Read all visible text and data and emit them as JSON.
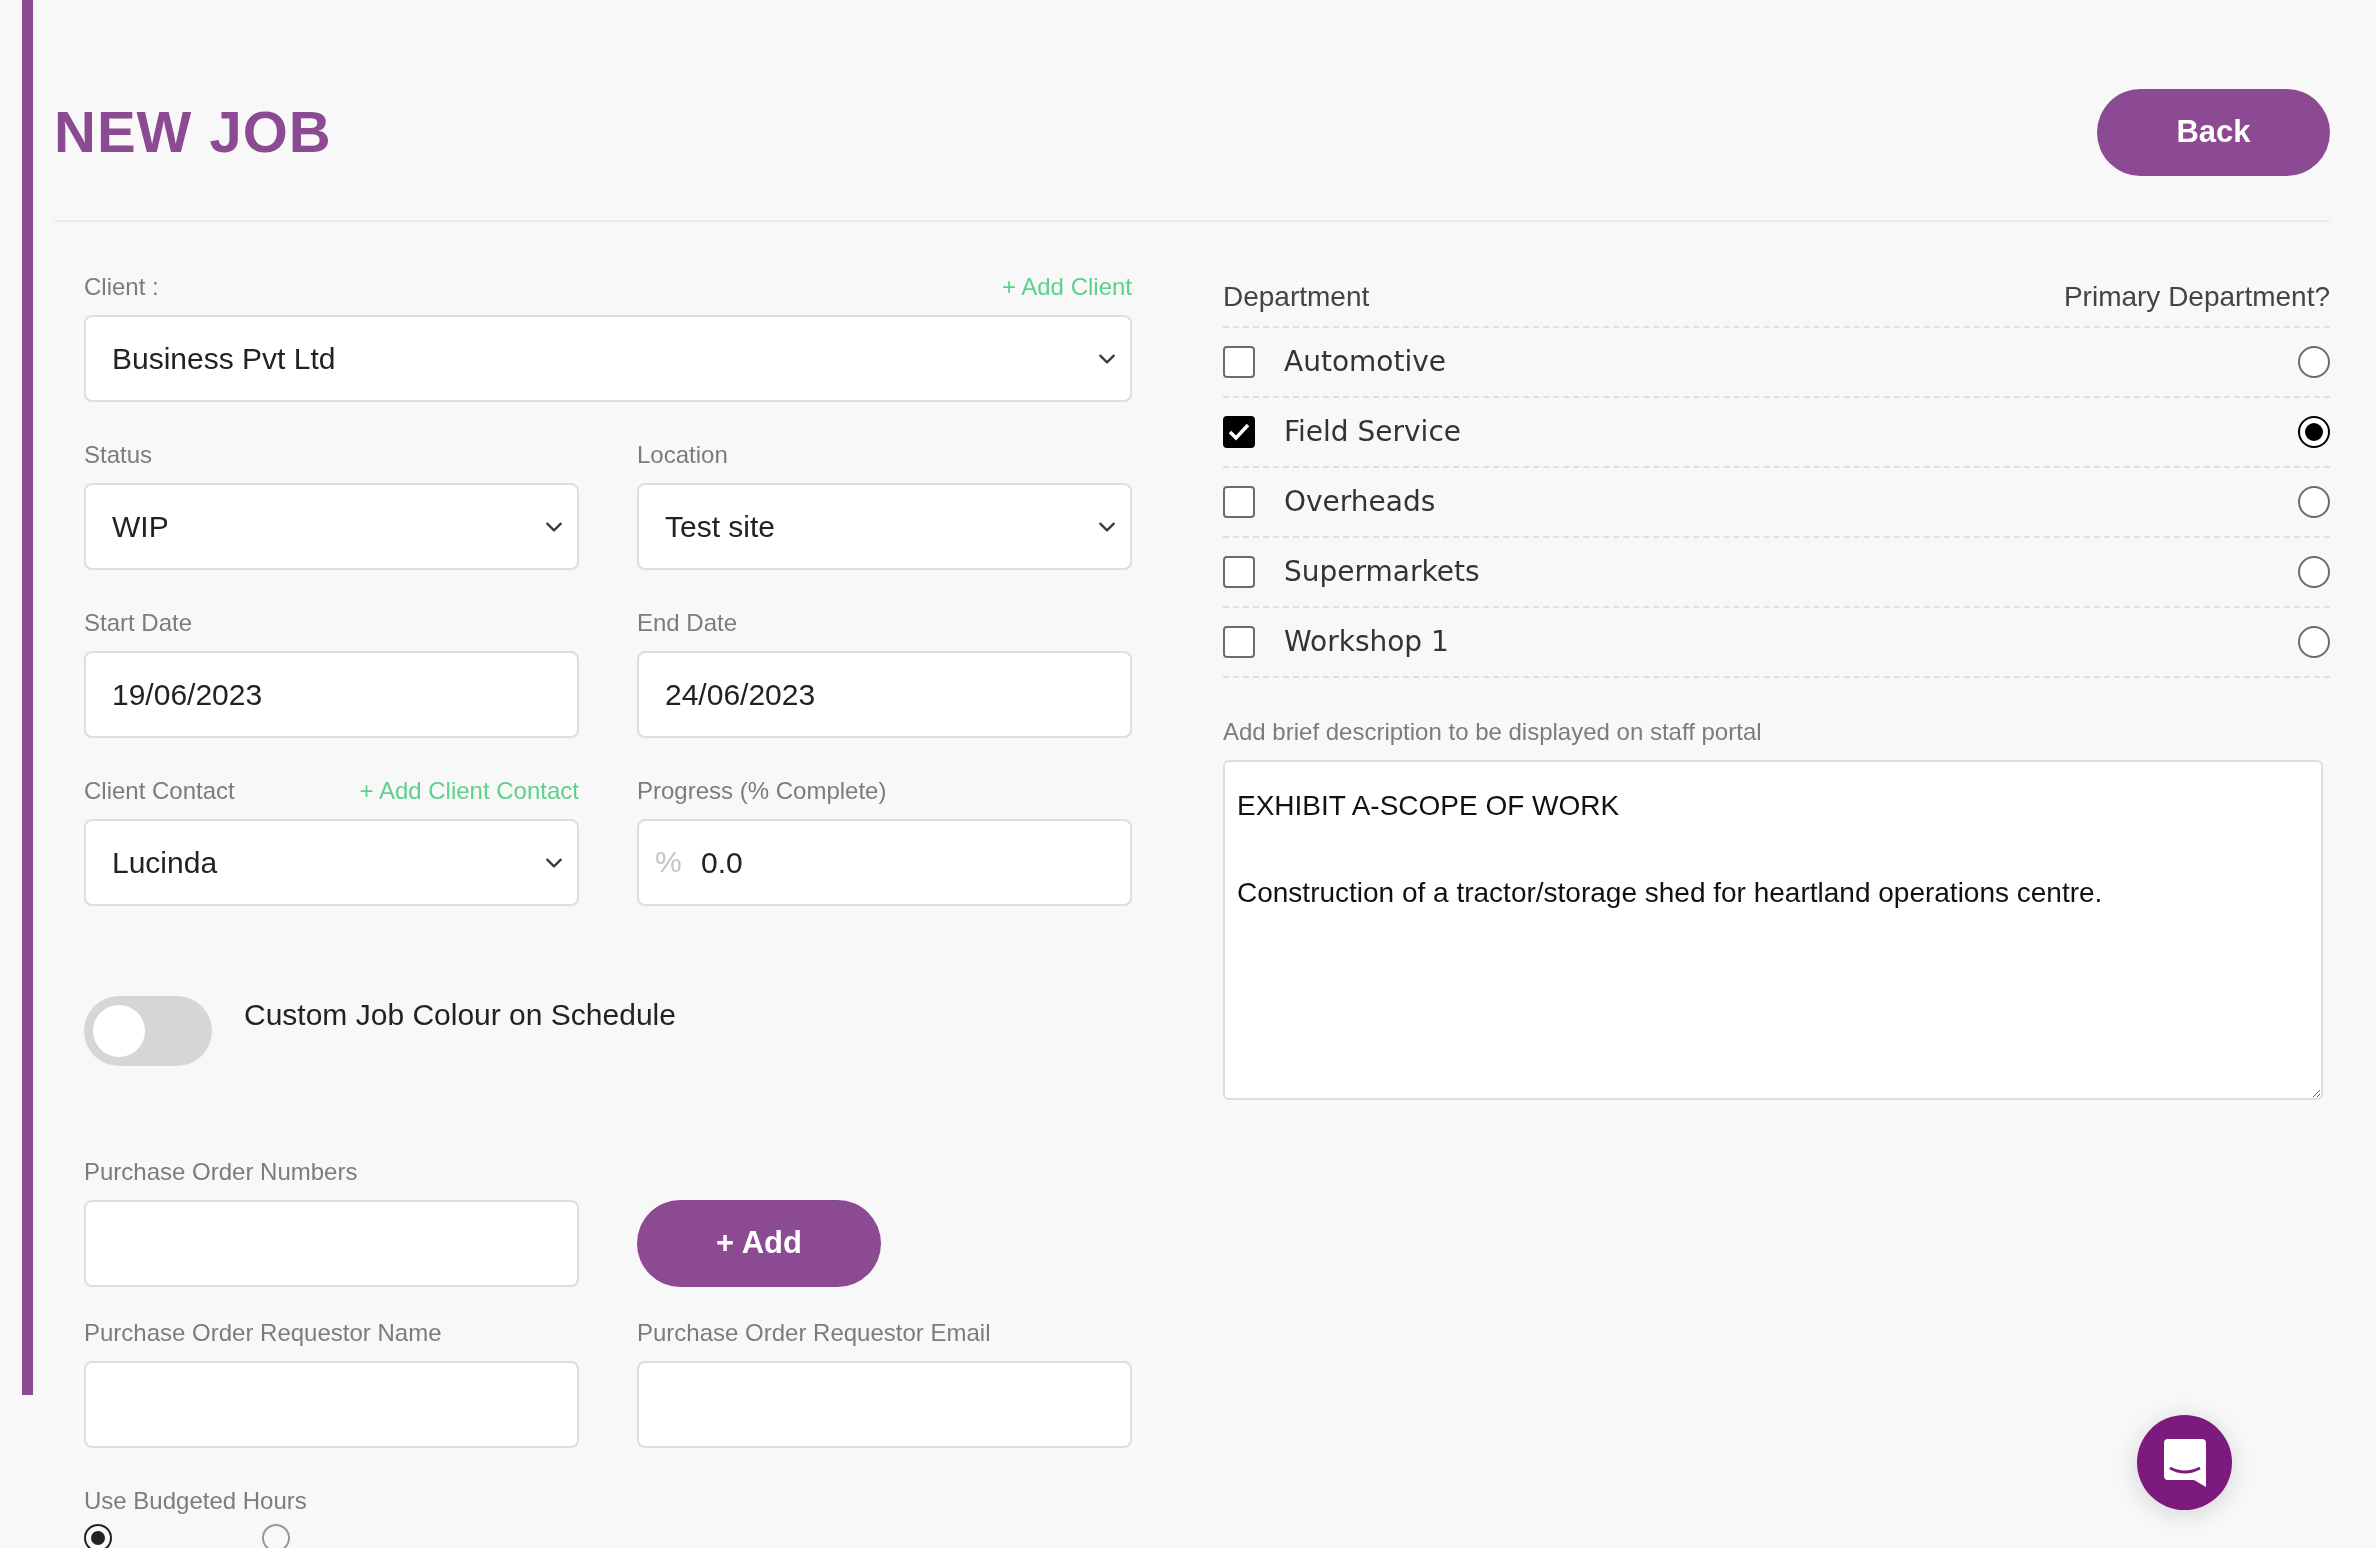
{
  "page": {
    "title": "NEW JOB",
    "back_button": "Back"
  },
  "client": {
    "label": "Client :",
    "add_link": "+ Add Client",
    "value": "Business Pvt Ltd"
  },
  "status": {
    "label": "Status",
    "value": "WIP"
  },
  "location": {
    "label": "Location",
    "value": "Test site"
  },
  "start_date": {
    "label": "Start Date",
    "value": "19/06/2023"
  },
  "end_date": {
    "label": "End Date",
    "value": "24/06/2023"
  },
  "client_contact": {
    "label": "Client Contact",
    "add_link": "+ Add Client Contact",
    "value": "Lucinda"
  },
  "progress": {
    "label": "Progress (% Complete)",
    "prefix": "%",
    "value": "0.0"
  },
  "custom_colour": {
    "label": "Custom Job Colour on Schedule",
    "on": false
  },
  "purchase_orders": {
    "label": "Purchase Order Numbers",
    "add_button": "+ Add"
  },
  "requestor_name": {
    "label": "Purchase Order Requestor Name"
  },
  "requestor_email": {
    "label": "Purchase Order Requestor Email"
  },
  "budgeted_hours": {
    "label": "Use Budgeted Hours",
    "options": [
      {
        "selected": true
      },
      {
        "selected": false
      }
    ]
  },
  "departments": {
    "column_1": "Department",
    "column_2": "Primary Department?",
    "items": [
      {
        "name": "Automotive",
        "checked": false,
        "selected": false
      },
      {
        "name": "Field Service",
        "checked": true,
        "selected": true
      },
      {
        "name": "Overheads",
        "checked": false,
        "selected": false
      },
      {
        "name": "Supermarkets",
        "checked": false,
        "selected": false
      },
      {
        "name": "Workshop 1",
        "checked": false,
        "selected": false
      }
    ]
  },
  "description": {
    "label": "Add brief description to be displayed on staff portal",
    "value": "EXHIBIT A-SCOPE OF WORK\n\nConstruction of a tractor/storage shed for heartland operations centre."
  }
}
